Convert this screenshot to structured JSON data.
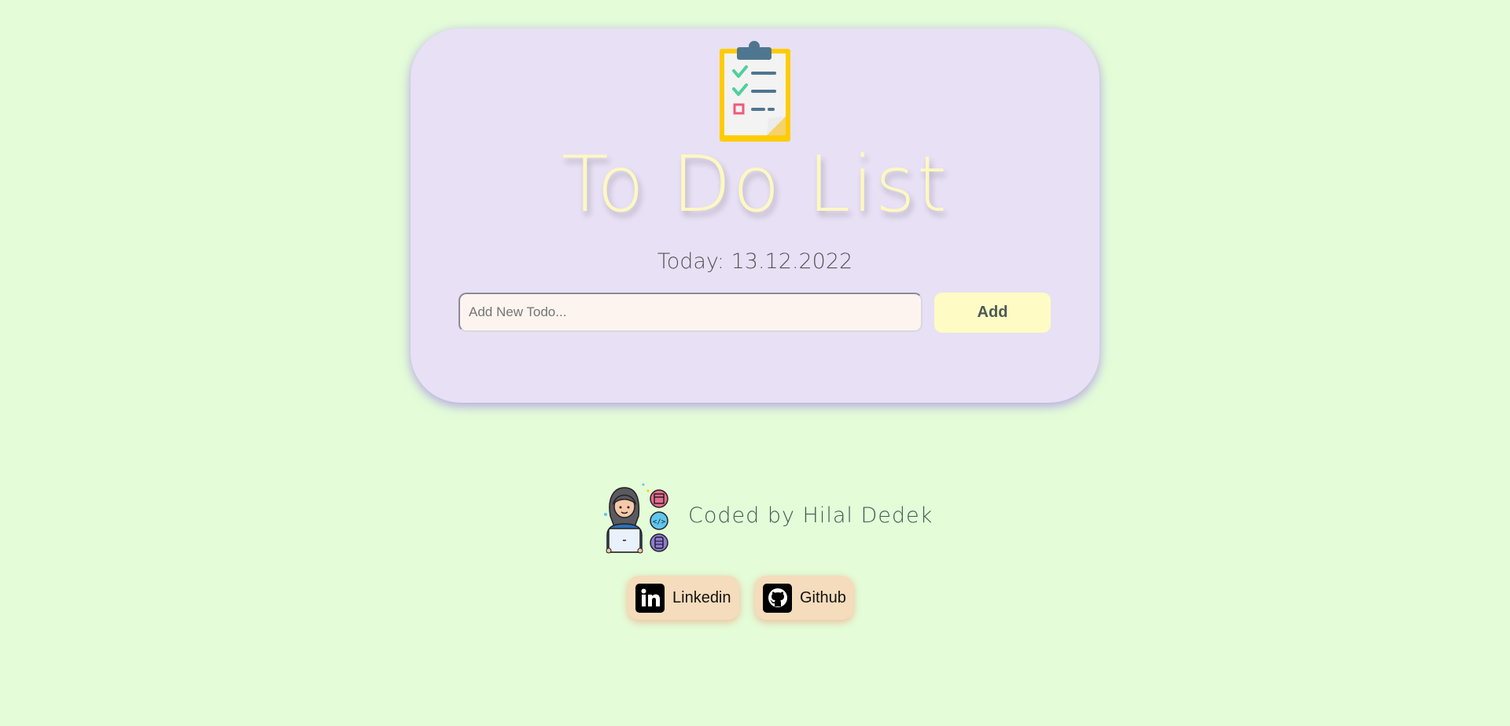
{
  "app": {
    "title": "To Do List",
    "date_text": "Today: 13.12.2022"
  },
  "form": {
    "placeholder": "Add New Todo...",
    "value": "",
    "add_label": "Add"
  },
  "footer": {
    "credit": "Coded by Hilal Dedek",
    "links": [
      {
        "label": "Linkedin",
        "icon": "linkedin-icon"
      },
      {
        "label": "Github",
        "icon": "github-icon"
      }
    ]
  },
  "colors": {
    "page_background": "#e4fdd8",
    "card_background": "#e8e0f5",
    "title": "#fdf8c2",
    "add_button": "#fefbc4",
    "social_button": "#f5dcbc"
  },
  "icons": {
    "logo": "clipboard-checklist-icon",
    "avatar": "developer-avatar-icon"
  }
}
